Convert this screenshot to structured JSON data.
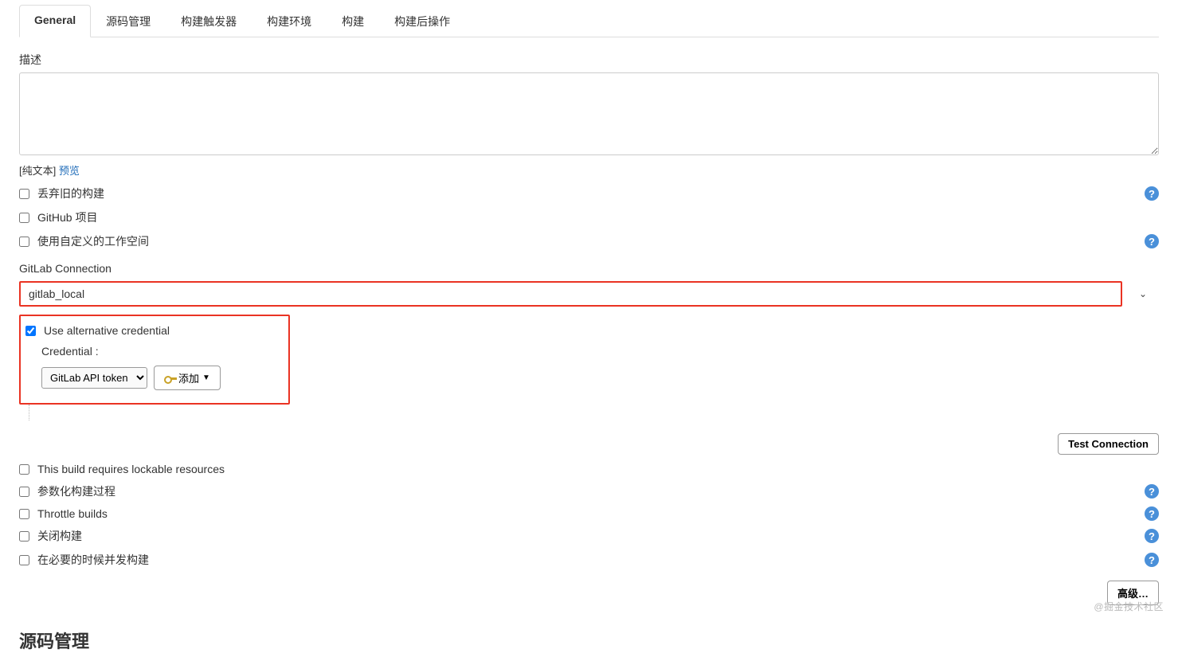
{
  "tabs": [
    "General",
    "源码管理",
    "构建触发器",
    "构建环境",
    "构建",
    "构建后操作"
  ],
  "activeTab": 0,
  "description": {
    "label": "描述",
    "value": "",
    "hintPrefix": "[纯文本] ",
    "previewLink": "预览"
  },
  "options": {
    "discardOld": "丢弃旧的构建",
    "githubProject": "GitHub 项目",
    "customWorkspace": "使用自定义的工作空间"
  },
  "gitlab": {
    "label": "GitLab Connection",
    "selectValue": "gitlab_local",
    "useAltCredLabel": "Use alternative credential",
    "useAltCredChecked": true,
    "credentialLabel": "Credential :",
    "credentialSelect": "GitLab API token",
    "addBtn": "添加",
    "testBtn": "Test Connection"
  },
  "moreOptions": {
    "lockable": "This build requires lockable resources",
    "parameterized": "参数化构建过程",
    "throttle": "Throttle builds",
    "close": "关闭构建",
    "concurrent": "在必要的时候并发构建"
  },
  "advancedBtn": "高级…",
  "sectionScm": "源码管理",
  "watermark": "@掘金技术社区"
}
